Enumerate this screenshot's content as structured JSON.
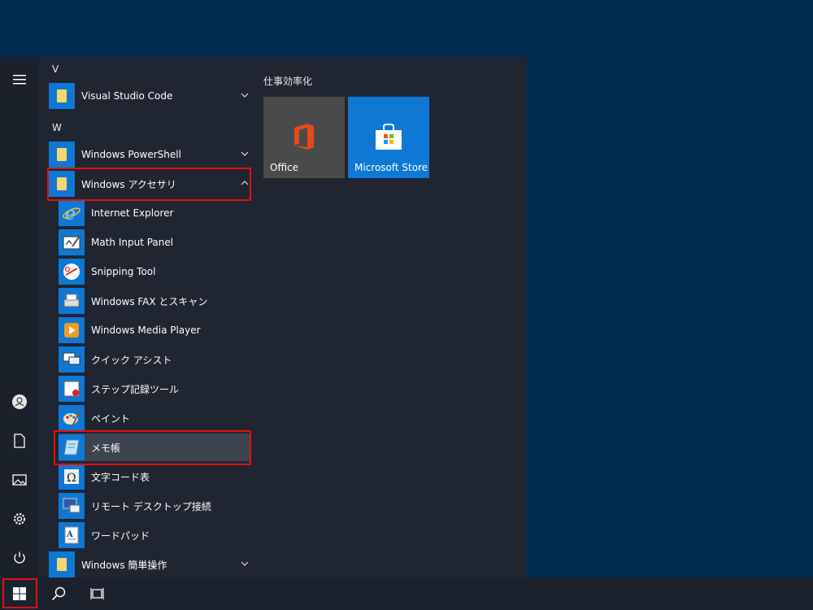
{
  "colors": {
    "accent": "#0e78d4",
    "menu_bg": "#1f2631",
    "highlight_red": "#e30f0f",
    "folder": "#f9d66b"
  },
  "applist": {
    "letter_v": "V",
    "letter_w": "W",
    "items": [
      {
        "label": "Visual Studio Code",
        "icon": "folder-icon"
      },
      {
        "label": "Windows PowerShell",
        "icon": "folder-icon"
      },
      {
        "label": "Windows アクセサリ",
        "icon": "folder-icon"
      },
      {
        "label": "Internet Explorer",
        "icon": "internet-explorer-icon"
      },
      {
        "label": "Math Input Panel",
        "icon": "math-input-panel-icon"
      },
      {
        "label": "Snipping Tool",
        "icon": "snipping-tool-icon"
      },
      {
        "label": "Windows FAX とスキャン",
        "icon": "fax-scan-icon"
      },
      {
        "label": "Windows Media Player",
        "icon": "media-player-icon"
      },
      {
        "label": "クイック アシスト",
        "icon": "quick-assist-icon"
      },
      {
        "label": "ステップ記録ツール",
        "icon": "steps-recorder-icon"
      },
      {
        "label": "ペイント",
        "icon": "paint-icon"
      },
      {
        "label": "メモ帳",
        "icon": "notepad-icon"
      },
      {
        "label": "文字コード表",
        "icon": "character-map-icon"
      },
      {
        "label": "リモート デスクトップ接続",
        "icon": "remote-desktop-icon"
      },
      {
        "label": "ワードパッド",
        "icon": "wordpad-icon"
      },
      {
        "label": "Windows 簡単操作",
        "icon": "folder-icon"
      }
    ]
  },
  "tiles": {
    "group_title": "仕事効率化",
    "office": "Office",
    "store": "Microsoft Store"
  }
}
